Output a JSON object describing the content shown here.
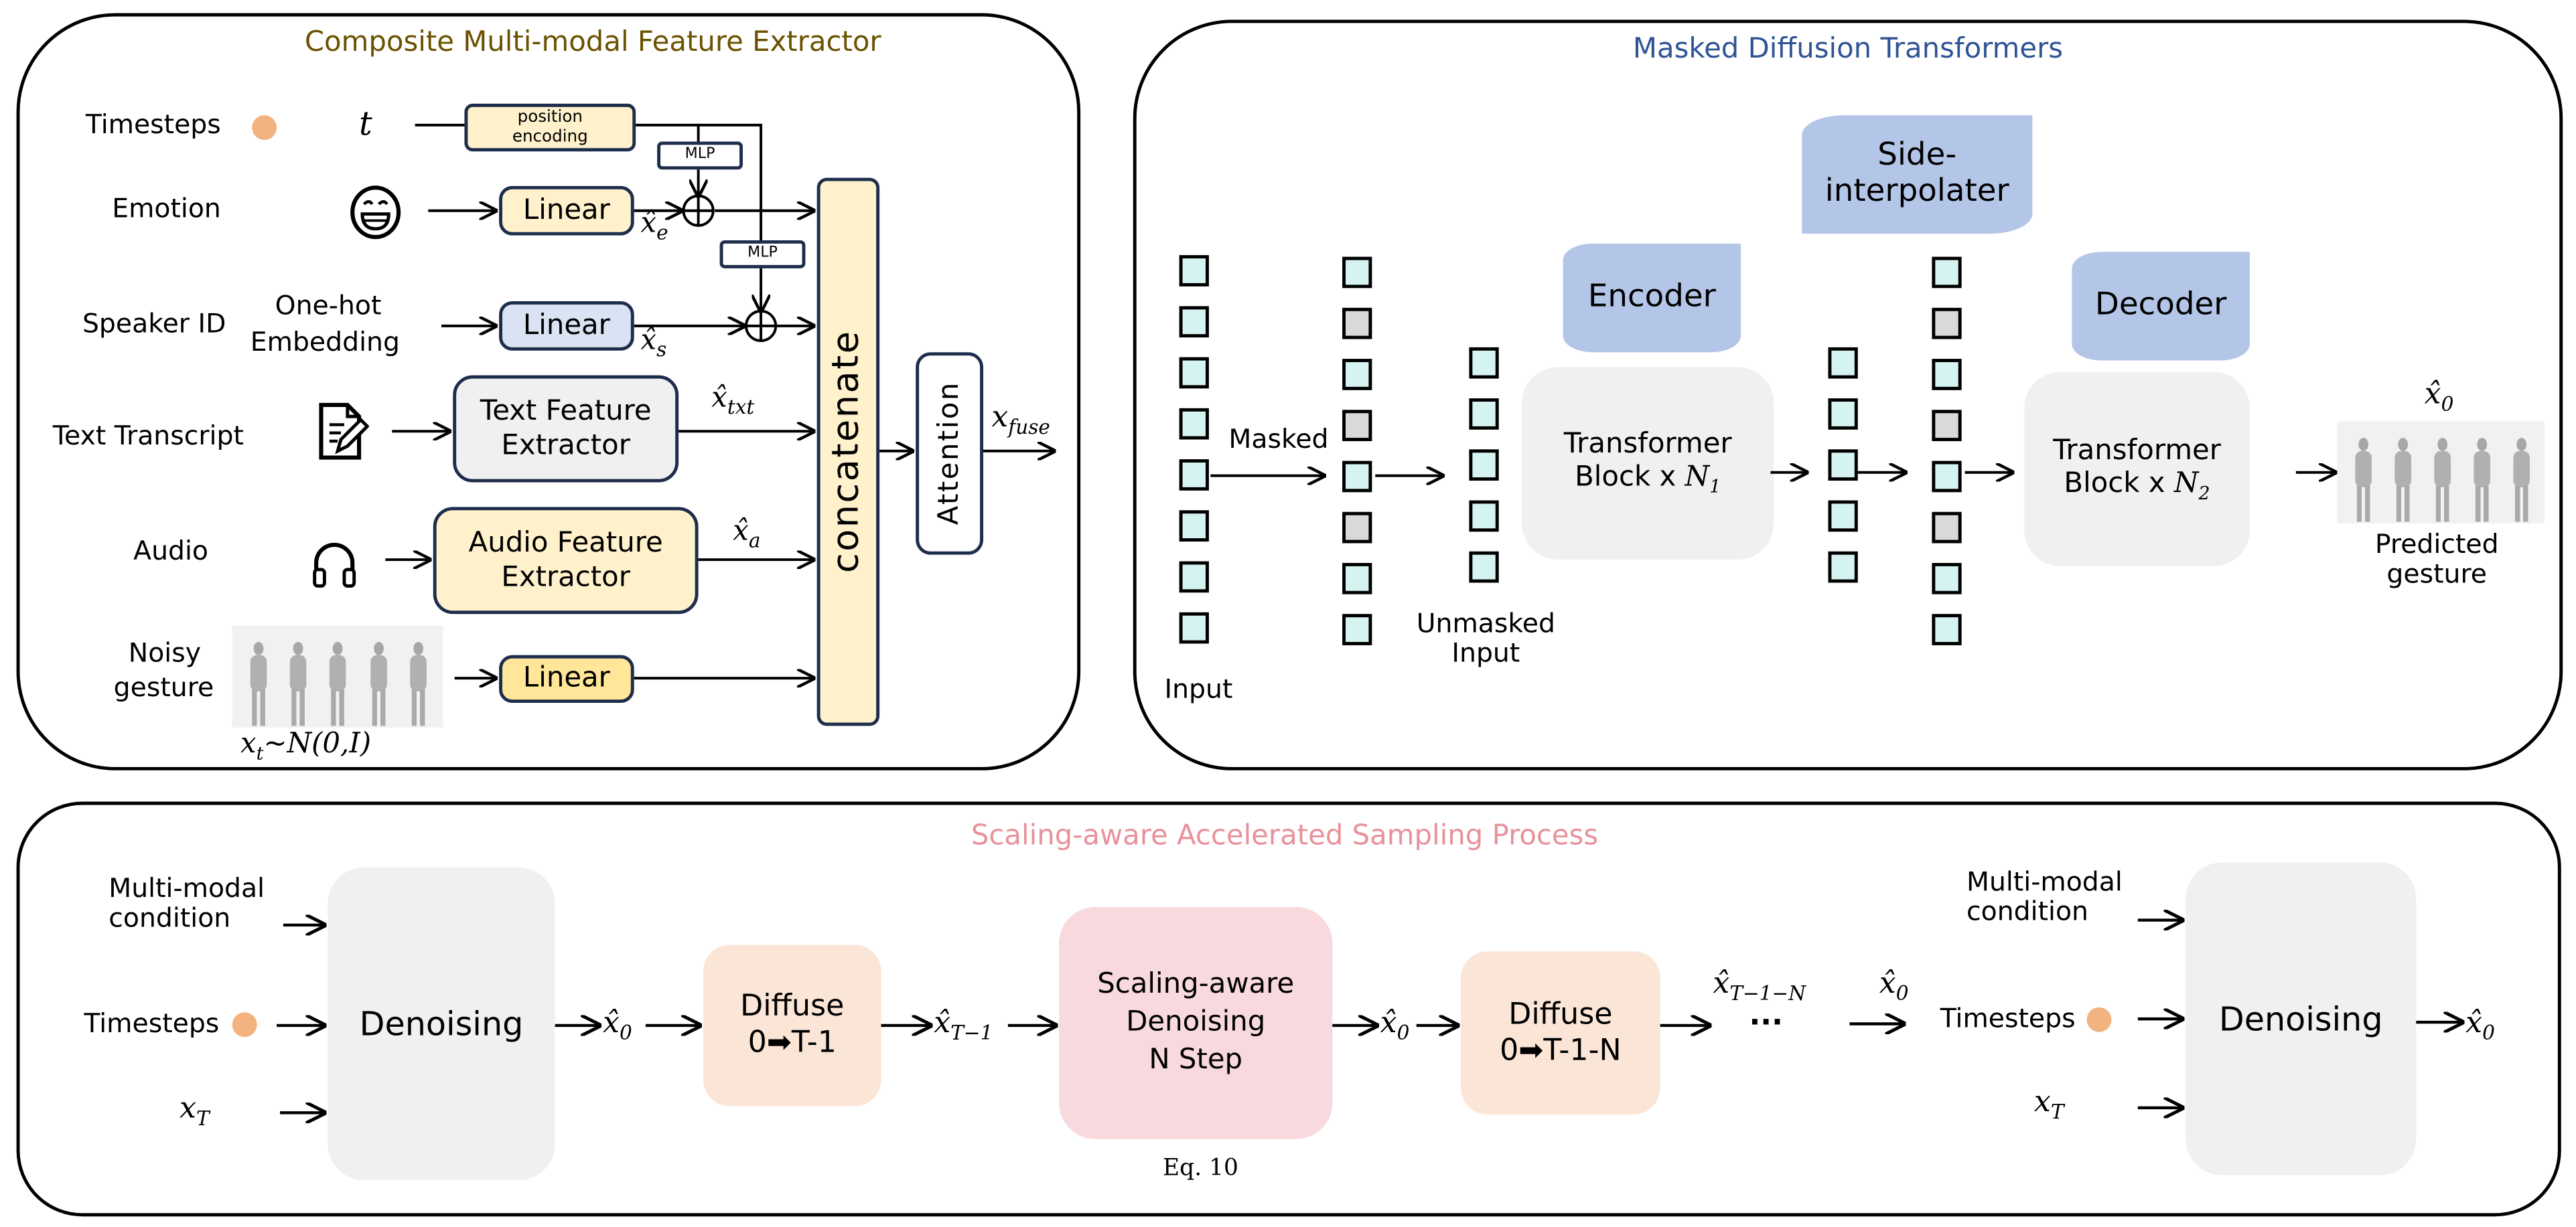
{
  "panels": {
    "extractor": {
      "title": "Composite Multi-modal Feature Extractor",
      "title_color": "#6b5200",
      "rows": {
        "timesteps": {
          "label": "Timesteps",
          "symbol": "t",
          "icon": "orange-dot-icon",
          "block": "position encoding"
        },
        "emotion": {
          "label": "Emotion",
          "icon": "grinning-face-icon",
          "block": "Linear",
          "output": "x̂",
          "output_sub": "e"
        },
        "speaker": {
          "label": "Speaker ID",
          "sublabel_1": "One-hot",
          "sublabel_2": "Embedding",
          "block": "Linear",
          "output": "x̂",
          "output_sub": "s"
        },
        "text": {
          "label": "Text Transcript",
          "icon": "document-pencil-icon",
          "block_line1": "Text Feature",
          "block_line2": "Extractor",
          "output": "x̂",
          "output_sub": "txt"
        },
        "audio": {
          "label": "Audio",
          "icon": "headphones-icon",
          "block_line1": "Audio Feature",
          "block_line2": "Extractor",
          "output": "x̂",
          "output_sub": "a"
        },
        "noisy": {
          "label_1": "Noisy",
          "label_2": "gesture",
          "block": "Linear",
          "caption": "x",
          "caption_sub": "t",
          "caption_rest": "~N(0,I)"
        }
      },
      "mlp_label": "MLP",
      "concat_label": "concatenate",
      "attention_label": "Attention",
      "fuse_output": "x",
      "fuse_output_sub": "fuse",
      "colors": {
        "yellow": "#fff1cc",
        "blue": "#dae3f3",
        "gray": "#f0f0f0",
        "gold": "#ffe699",
        "border": "#1f2d4d"
      }
    },
    "mdt": {
      "title": "Masked Diffusion Transformers",
      "title_color": "#2f5496",
      "input_label": "Input",
      "masked_label": "Masked",
      "unmasked_label_1": "Unmasked",
      "unmasked_label_2": "Input",
      "encoder_label": "Encoder",
      "decoder_label": "Decoder",
      "side_label_1": "Side-",
      "side_label_2": "interpolater",
      "enc_block_line1": "Transformer",
      "enc_block_line2": "Block x ",
      "enc_block_n": "N",
      "enc_block_n_sub": "1",
      "dec_block_line1": "Transformer",
      "dec_block_line2": "Block x ",
      "dec_block_n": "N",
      "dec_block_n_sub": "2",
      "output_symbol": "x̂",
      "output_sub": "0",
      "predicted_1": "Predicted",
      "predicted_2": "gesture",
      "input_tokens": [
        "u",
        "u",
        "u",
        "u",
        "u",
        "u",
        "u",
        "u"
      ],
      "masked_tokens": [
        "u",
        "m",
        "u",
        "m",
        "u",
        "m",
        "u",
        "u"
      ],
      "unmasked_tokens": [
        "u",
        "u",
        "u",
        "u",
        "u"
      ],
      "encoded_tokens": [
        "u",
        "u",
        "u",
        "u",
        "u"
      ],
      "interpolated_tokens": [
        "u",
        "m",
        "u",
        "m",
        "u",
        "m",
        "u",
        "u"
      ],
      "colors": {
        "token": "#d5f3f0",
        "masked_token": "#d9d9d9",
        "banner": "#b4c6e8"
      }
    },
    "sampling": {
      "title": "Scaling-aware Accelerated Sampling Process",
      "title_color": "#e8919b",
      "left_inputs": {
        "cond_1": "Multi-modal",
        "cond_2": "condition",
        "timesteps": "Timesteps",
        "xT": "x",
        "xT_sub": "T"
      },
      "denoising_label": "Denoising",
      "x0": "x̂",
      "x0_sub": "0",
      "diffuse1_line1": "Diffuse",
      "diffuse1_line2": "0➡T-1",
      "xT1": "x̂",
      "xT1_sub": "T−1",
      "scaling_line1": "Scaling-aware",
      "scaling_line2": "Denoising",
      "scaling_line3": "N Step",
      "eq_label": "Eq. 10",
      "diffuse2_line1": "Diffuse",
      "diffuse2_line2": "0➡T-1-N",
      "xT1N": "x̂",
      "xT1N_sub": "T−1−N",
      "ellipsis": "···",
      "right_inputs": {
        "cond_1": "Multi-modal",
        "cond_2": "condition",
        "timesteps": "Timesteps",
        "xT": "x",
        "xT_sub": "T"
      },
      "colors": {
        "denoise": "#f0f0f0",
        "diffuse": "#fbe5d6",
        "scaling": "#f8d9de"
      }
    }
  }
}
